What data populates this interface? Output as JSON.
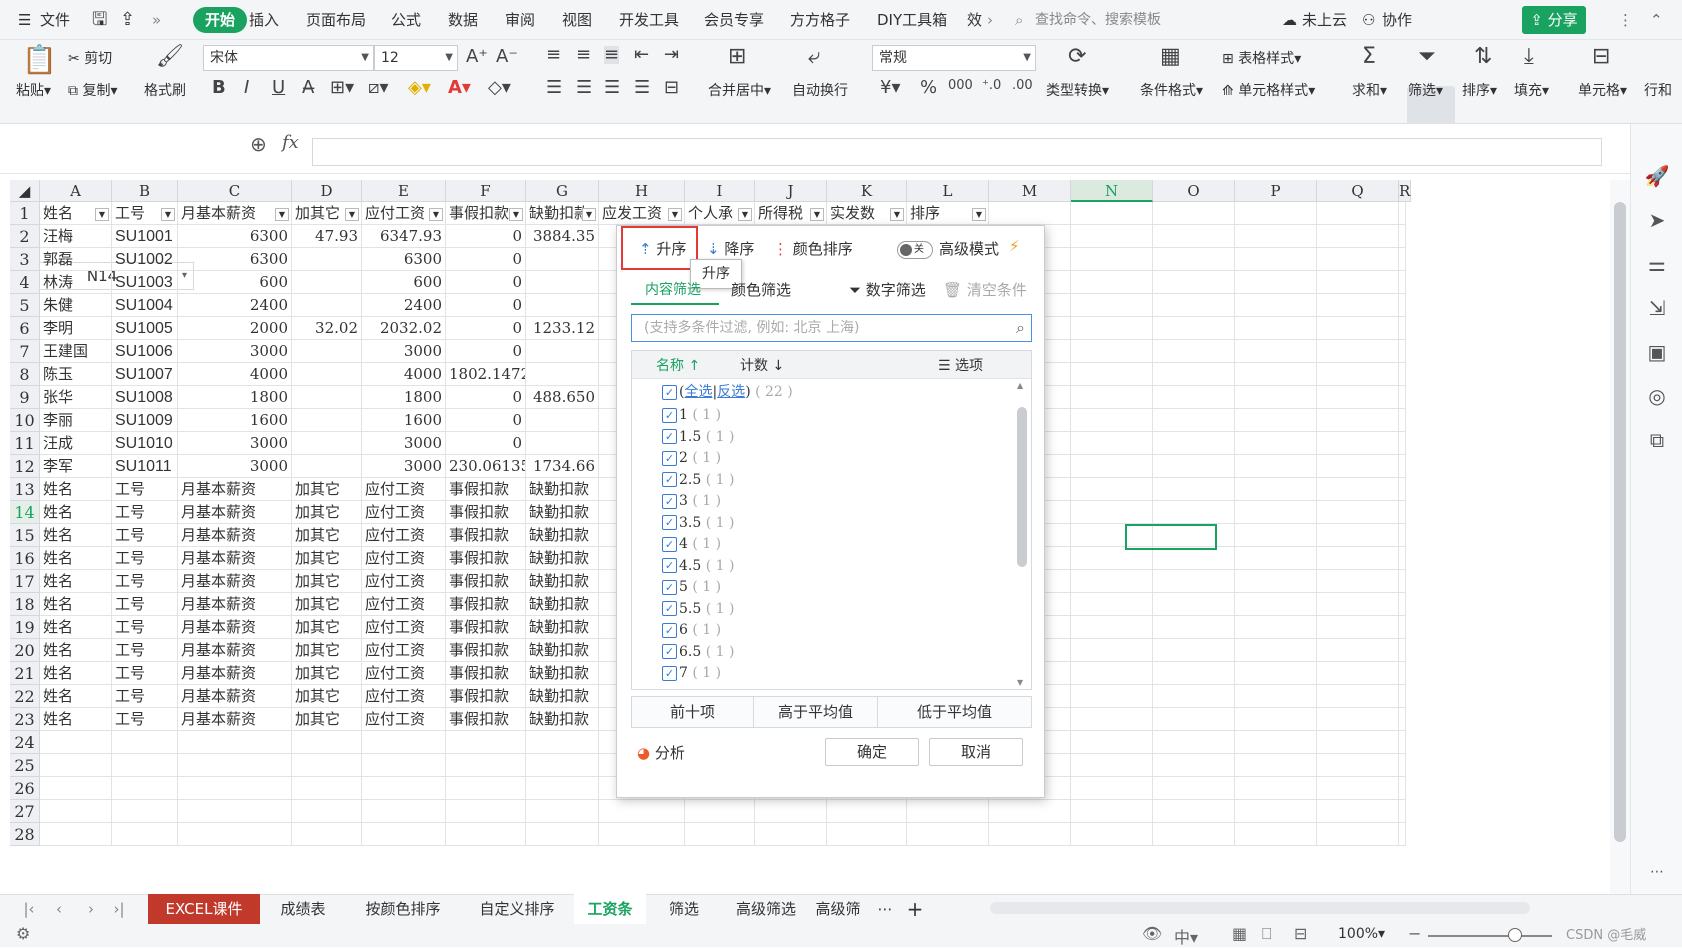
{
  "menubar": {
    "file": "文件",
    "tabs": [
      "开始",
      "插入",
      "页面布局",
      "公式",
      "数据",
      "审阅",
      "视图",
      "开发工具",
      "会员专享",
      "方方格子",
      "DIY工具箱",
      "效"
    ],
    "search_placeholder": "查找命令、搜索模板",
    "cloud": "未上云",
    "collab": "协作",
    "share": "分享"
  },
  "ribbon": {
    "paste": "粘贴",
    "cut": "剪切",
    "copy": "复制",
    "format_painter": "格式刷",
    "font_name": "宋体",
    "font_size": "12",
    "number_format": "常规",
    "merge_center": "合并居中",
    "wrap_text": "自动换行",
    "type_convert": "类型转换",
    "cond_format": "条件格式",
    "table_style": "表格样式",
    "cell_style": "单元格样式",
    "sum": "求和",
    "filter": "筛选",
    "sort": "排序",
    "fill": "填充",
    "cells": "单元格",
    "rows": "行和"
  },
  "formula_bar": {
    "name_box": "N14",
    "fx": "fx"
  },
  "columns": [
    "A",
    "B",
    "C",
    "D",
    "E",
    "F",
    "G",
    "H",
    "I",
    "J",
    "K",
    "L",
    "M",
    "N",
    "O",
    "P",
    "Q",
    "R"
  ],
  "header_row": [
    "姓名",
    "工号",
    "月基本薪资",
    "加其它",
    "应付工资",
    "事假扣款",
    "缺勤扣款",
    "应发工资",
    "个人承",
    "所得税",
    "实发数",
    "排序"
  ],
  "rows": [
    [
      "汪梅",
      "SU1001",
      "6300",
      "47.93",
      "6347.93",
      "0",
      "3884.35"
    ],
    [
      "郭磊",
      "SU1002",
      "6300",
      "",
      "6300",
      "0",
      ""
    ],
    [
      "林涛",
      "SU1003",
      "600",
      "",
      "600",
      "0",
      ""
    ],
    [
      "朱健",
      "SU1004",
      "2400",
      "",
      "2400",
      "0",
      ""
    ],
    [
      "李明",
      "SU1005",
      "2000",
      "32.02",
      "2032.02",
      "0",
      "1233.12"
    ],
    [
      "王建国",
      "SU1006",
      "3000",
      "",
      "3000",
      "0",
      ""
    ],
    [
      "陈玉",
      "SU1007",
      "4000",
      "",
      "4000",
      "1802.1472",
      ""
    ],
    [
      "张华",
      "SU1008",
      "1800",
      "",
      "1800",
      "0",
      "488.650"
    ],
    [
      "李丽",
      "SU1009",
      "1600",
      "",
      "1600",
      "0",
      ""
    ],
    [
      "汪成",
      "SU1010",
      "3000",
      "",
      "3000",
      "0",
      ""
    ],
    [
      "李军",
      "SU1011",
      "3000",
      "",
      "3000",
      "230.06135",
      "1734.66"
    ]
  ],
  "repeat_row": [
    "姓名",
    "工号",
    "月基本薪资",
    "加其它",
    "应付工资",
    "事假扣款",
    "缺勤扣款"
  ],
  "repeat_count": 11,
  "row_numbers": [
    "1",
    "2",
    "3",
    "4",
    "5",
    "6",
    "7",
    "8",
    "9",
    "10",
    "11",
    "12",
    "13",
    "14",
    "15",
    "16",
    "17",
    "18",
    "19",
    "20",
    "21",
    "22",
    "23",
    "24",
    "25",
    "26",
    "27",
    "28"
  ],
  "filter_popup": {
    "asc": "升序",
    "desc": "降序",
    "color_sort": "颜色排序",
    "toggle": "关",
    "advanced": "高级模式",
    "tooltip": "升序",
    "tab_content": "内容筛选",
    "tab_color": "颜色筛选",
    "number_filter": "数字筛选",
    "clear": "清空条件",
    "search_placeholder": "(支持多条件过滤, 例如: 北京 上海)",
    "col_name": "名称",
    "col_count": "计数",
    "options": "选项",
    "select_all": "全选",
    "invert": "反选",
    "total": "( 22 )",
    "items": [
      {
        "name": "1",
        "count": "( 1 )"
      },
      {
        "name": "1.5",
        "count": "( 1 )"
      },
      {
        "name": "2",
        "count": "( 1 )"
      },
      {
        "name": "2.5",
        "count": "( 1 )"
      },
      {
        "name": "3",
        "count": "( 1 )"
      },
      {
        "name": "3.5",
        "count": "( 1 )"
      },
      {
        "name": "4",
        "count": "( 1 )"
      },
      {
        "name": "4.5",
        "count": "( 1 )"
      },
      {
        "name": "5",
        "count": "( 1 )"
      },
      {
        "name": "5.5",
        "count": "( 1 )"
      },
      {
        "name": "6",
        "count": "( 1 )"
      },
      {
        "name": "6.5",
        "count": "( 1 )"
      },
      {
        "name": "7",
        "count": "( 1 )"
      }
    ],
    "top10": "前十项",
    "above_avg": "高于平均值",
    "below_avg": "低于平均值",
    "analysis": "分析",
    "ok": "确定",
    "cancel": "取消"
  },
  "sheet_tabs": [
    "EXCEL课件",
    "成绩表",
    "按颜色排序",
    "自定义排序",
    "工资条",
    "筛选",
    "高级筛选",
    "高级筛"
  ],
  "status": {
    "zoom": "100%",
    "watermark": "CSDN @毛威"
  },
  "colors": {
    "accent": "#1aa260",
    "highlight": "#e53935",
    "link": "#3a7bd5"
  }
}
